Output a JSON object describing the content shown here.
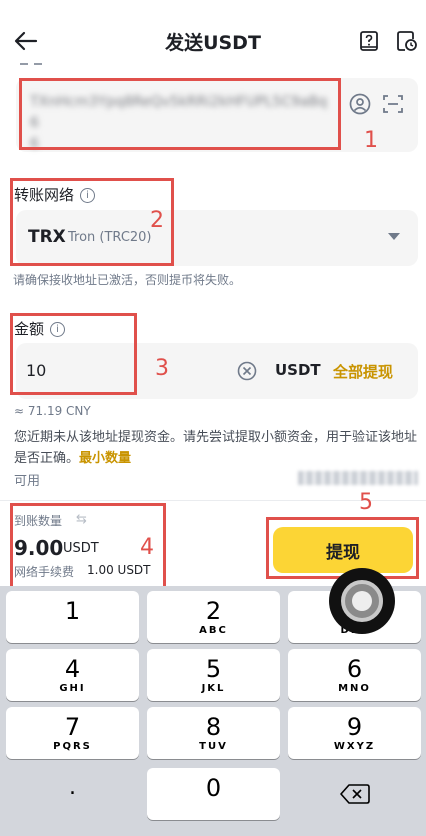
{
  "header": {
    "title": "发送USDT"
  },
  "address": {
    "value": "TXnHcm3Ypq8ReQv5kRRi2kHFUPL5C9aBq6",
    "line2": "6"
  },
  "network": {
    "label": "转账网络",
    "symbol": "TRX",
    "name": "Tron (TRC20)",
    "hint": "请确保接收地址已激活，否则提币将失败。"
  },
  "amount": {
    "label": "金额",
    "value": "10",
    "unit": "USDT",
    "all_label": "全部提现",
    "cny": "≈ 71.19 CNY"
  },
  "notice": {
    "text": "您近期未从该地址提现资金。请先尝试提取小额资金，用于验证该地址是否正确。",
    "link": "最小数量"
  },
  "available": {
    "label": "可用"
  },
  "receive": {
    "label": "到账数量",
    "value": "9.00",
    "unit": "USDT",
    "fee_label": "网络手续费",
    "fee_value": "1.00 USDT"
  },
  "submit": {
    "label": "提现"
  },
  "markers": [
    "1",
    "2",
    "3",
    "4",
    "5"
  ],
  "keypad": {
    "keys": [
      {
        "num": "1",
        "sub": ""
      },
      {
        "num": "2",
        "sub": "ABC"
      },
      {
        "num": "3",
        "sub": "DEF"
      },
      {
        "num": "4",
        "sub": "GHI"
      },
      {
        "num": "5",
        "sub": "JKL"
      },
      {
        "num": "6",
        "sub": "MNO"
      },
      {
        "num": "7",
        "sub": "PQRS"
      },
      {
        "num": "8",
        "sub": "TUV"
      },
      {
        "num": "9",
        "sub": "WXYZ"
      },
      {
        "num": ".",
        "sub": ""
      },
      {
        "num": "0",
        "sub": ""
      }
    ],
    "delete_icon": "backspace-icon"
  },
  "colors": {
    "accent": "#fcd535",
    "link": "#c99400",
    "annotation": "#e0504b"
  }
}
